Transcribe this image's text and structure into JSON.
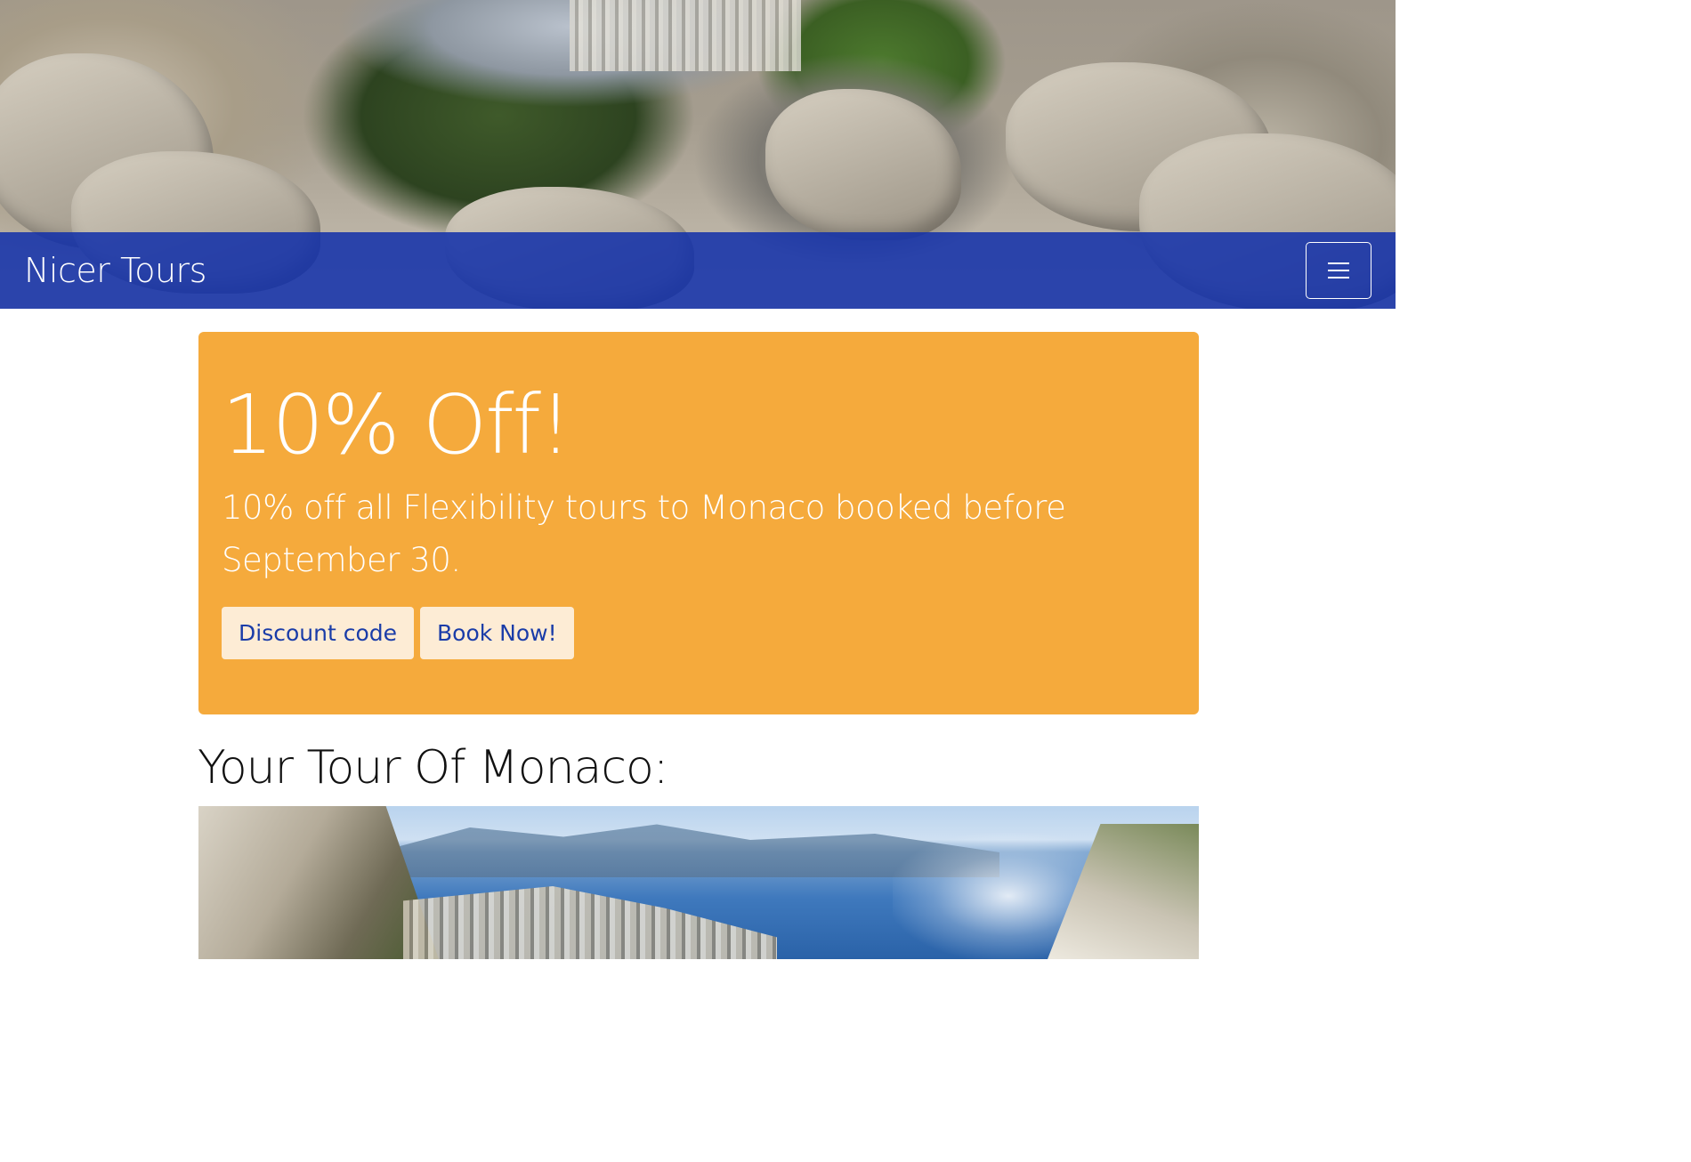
{
  "header": {
    "brand": "Nicer Tours",
    "menu_icon": "hamburger-menu-icon"
  },
  "promo": {
    "title": "10% Off!",
    "text": "10% off all Flexibility tours to Monaco booked before September 30.",
    "discount_label": "Discount code",
    "book_label": "Book Now!"
  },
  "section": {
    "heading": "Your Tour Of Monaco:"
  },
  "colors": {
    "navbar": "#1230aa",
    "promo_background": "#f5aa3c",
    "promo_button_background": "#fdecd5",
    "promo_button_text": "#1a3ca8"
  }
}
